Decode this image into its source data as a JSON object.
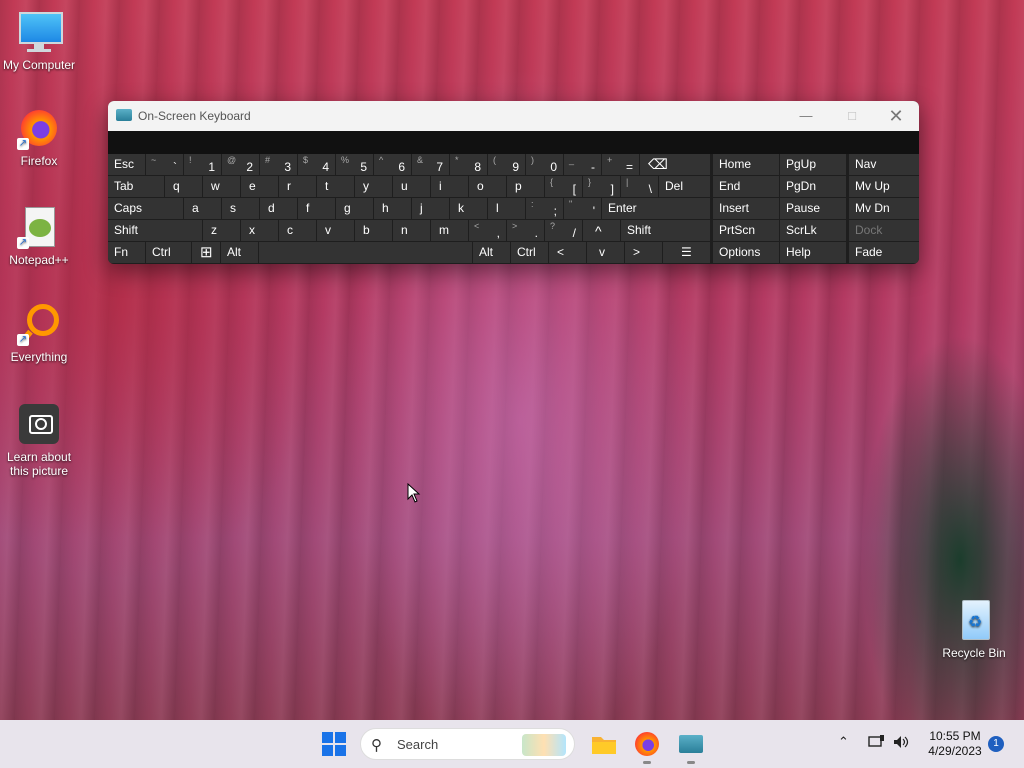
{
  "desktop": {
    "icons": [
      {
        "label": "My Computer"
      },
      {
        "label": "Firefox"
      },
      {
        "label": "Notepad++"
      },
      {
        "label": "Everything"
      },
      {
        "label": "Learn about this picture"
      },
      {
        "label": "Recycle Bin"
      }
    ]
  },
  "osk": {
    "title": "On-Screen Keyboard",
    "keys": {
      "esc": "Esc",
      "tilde_sub": "~",
      "grave": "`",
      "n1_sub": "!",
      "n1": "1",
      "n2_sub": "@",
      "n2": "2",
      "n3_sub": "#",
      "n3": "3",
      "n4_sub": "$",
      "n4": "4",
      "n5_sub": "%",
      "n5": "5",
      "n6_sub": "^",
      "n6": "6",
      "n7_sub": "&",
      "n7": "7",
      "n8_sub": "*",
      "n8": "8",
      "n9_sub": "(",
      "n9": "9",
      "n0_sub": ")",
      "n0": "0",
      "minus_sub": "_",
      "minus": "-",
      "eq_sub": "+",
      "eq": "=",
      "backspace": "⌫",
      "tab": "Tab",
      "q": "q",
      "w": "w",
      "e": "e",
      "r": "r",
      "t": "t",
      "y": "y",
      "u": "u",
      "i": "i",
      "o": "o",
      "p": "p",
      "lbr_sub": "{",
      "lbr": "[",
      "rbr_sub": "}",
      "rbr": "]",
      "bsl_sub": "|",
      "bsl": "\\",
      "del": "Del",
      "caps": "Caps",
      "a": "a",
      "s": "s",
      "d": "d",
      "f": "f",
      "g": "g",
      "h": "h",
      "j": "j",
      "k": "k",
      "l": "l",
      "semi_sub": ":",
      "semi": ";",
      "quote_sub": "\"",
      "quote": "'",
      "enter": "Enter",
      "shift_l": "Shift",
      "z": "z",
      "x": "x",
      "c": "c",
      "v": "v",
      "b": "b",
      "n": "n",
      "m": "m",
      "comma_sub": "<",
      "comma": ",",
      "period_sub": ">",
      "period": ".",
      "slash_sub": "?",
      "slash": "/",
      "up": "^",
      "shift_r": "Shift",
      "fn": "Fn",
      "ctrl_l": "Ctrl",
      "win": "⊞",
      "alt_l": "Alt",
      "alt_r": "Alt",
      "ctrl_r": "Ctrl",
      "left": "<",
      "down": "v",
      "right": ">",
      "menu": "☰",
      "home": "Home",
      "pgup": "PgUp",
      "nav": "Nav",
      "end": "End",
      "pgdn": "PgDn",
      "mvup": "Mv Up",
      "insert": "Insert",
      "pause": "Pause",
      "mvdn": "Mv Dn",
      "prtscn": "PrtScn",
      "scrlk": "ScrLk",
      "dock": "Dock",
      "options": "Options",
      "help": "Help",
      "fade": "Fade"
    }
  },
  "taskbar": {
    "search_placeholder": "Search",
    "time": "10:55 PM",
    "date": "4/29/2023",
    "notification_count": "1"
  }
}
